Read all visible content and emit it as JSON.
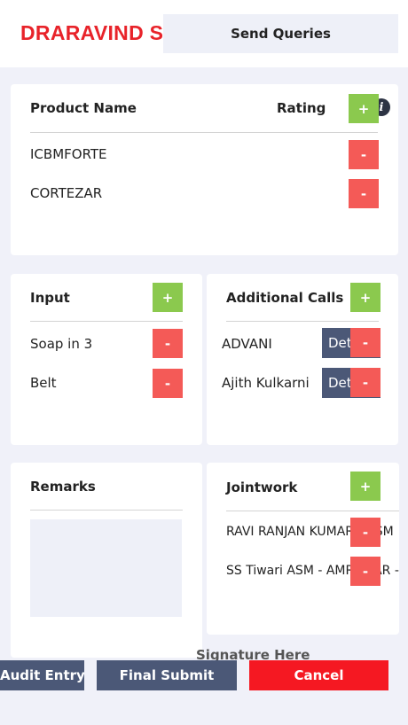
{
  "header": {
    "doctor_name": "DRARAVIND S",
    "send_queries_label": "Send Queries"
  },
  "products": {
    "col_name": "Product Name",
    "col_rating": "Rating",
    "add_symbol": "+",
    "info_symbol": "i",
    "remove_symbol": "-",
    "rows": [
      "ICBMFORTE",
      "CORTEZAR"
    ]
  },
  "input": {
    "title": "Input",
    "add_symbol": "+",
    "remove_symbol": "-",
    "rows": [
      "Soap in 3",
      "Belt"
    ]
  },
  "additional_calls": {
    "title": "Additional Calls",
    "add_symbol": "+",
    "remove_symbol": "-",
    "details_label": "Det",
    "rows": [
      "ADVANI",
      "Ajith Kulkarni"
    ]
  },
  "remarks": {
    "title": "Remarks"
  },
  "jointwork": {
    "title": "Jointwork",
    "add_symbol": "+",
    "remove_symbol": "-",
    "rows": [
      "RAVI RANJAN KUMAR - RSM",
      "SS Tiwari  ASM - AMRITSAR - MU"
    ]
  },
  "signature_label": "Signature Here",
  "footer": {
    "audit_entry": "Audit Entry",
    "final_submit": "Final Submit",
    "cancel": "Cancel"
  },
  "colors": {
    "brand_red": "#e8232a",
    "add_green": "#8bc94e",
    "remove_red": "#f45a57",
    "navy_button": "#4b5877",
    "cancel_red": "#f51822"
  }
}
